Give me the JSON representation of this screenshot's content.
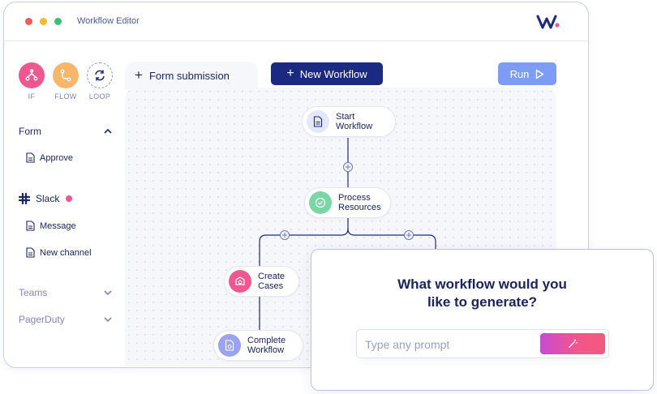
{
  "window": {
    "title": "Workflow Editor"
  },
  "colors": {
    "accent": "#1b2a80",
    "run": "#7d9df5",
    "pink": "#f0578f",
    "orange": "#f9b56a"
  },
  "tools": [
    {
      "label": "IF",
      "icon": "branch-icon"
    },
    {
      "label": "FLOW",
      "icon": "flow-icon"
    },
    {
      "label": "LOOP",
      "icon": "loop-icon"
    }
  ],
  "sidebar": {
    "form": {
      "label": "Form",
      "items": [
        "Approve"
      ]
    },
    "slack": {
      "label": "Slack",
      "items": [
        "Message",
        "New channel"
      ]
    },
    "teams": {
      "label": "Teams"
    },
    "pagerduty": {
      "label": "PagerDuty"
    }
  },
  "toolbar": {
    "tab_label": "Form submission",
    "new_workflow_label": "New Workflow",
    "run_label": "Run"
  },
  "nodes": {
    "start": {
      "line1": "Start",
      "line2": "Workflow"
    },
    "process": {
      "line1": "Process",
      "line2": "Resources"
    },
    "create": {
      "line1": "Create",
      "line2": "Cases"
    },
    "complete": {
      "line1": "Complete",
      "line2": "Workflow"
    }
  },
  "popup": {
    "line1": "What workflow would you",
    "line2": "like to generate?",
    "placeholder": "Type any prompt"
  }
}
